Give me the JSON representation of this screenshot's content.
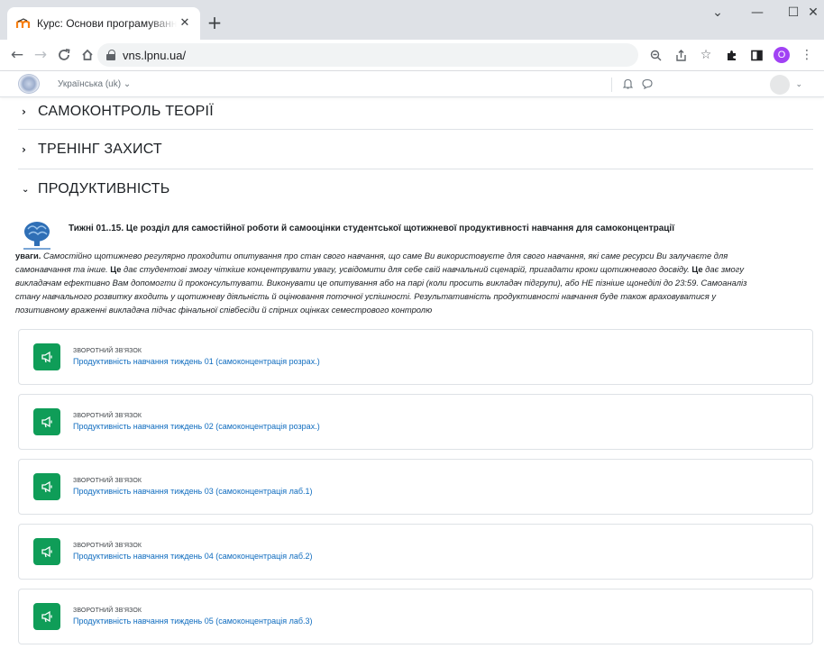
{
  "browser": {
    "tab_title": "Курс: Основи програмування, ч",
    "new_tab": "+",
    "url": "vns.lpnu.ua/",
    "profile_initial": "O"
  },
  "site": {
    "language": "Українська (uk)"
  },
  "sections": [
    {
      "title": "САМОКОНТРОЛЬ ТЕОРІЇ",
      "expanded": false
    },
    {
      "title": "ТРЕНІНГ ЗАХИСТ",
      "expanded": false
    },
    {
      "title": "ПРОДУКТИВНІСТЬ",
      "expanded": true
    }
  ],
  "summary": {
    "heading": "Тижні 01..15. Це розділ для самостійної роботи й самооцінки студентської щотижневої продуктивності навчання для самоконцентрації",
    "lead": "уваги.",
    "part1": " Самостійно щотижнево регулярно проходити опитування про стан свого навчання, що саме Ви використовуєте для свого навчання, які саме ресурси Ви залучаєте для самонавчання та інше. ",
    "bold1": "Це",
    "part2": " дає студентові змогу чіткіше концентрувати увагу, усвідомити для себе свій навчальний сценарій, пригадати кроки щотижневого досвіду. ",
    "bold2": "Це",
    "part3": " дає змогу викладачам ефективно Вам допомогти й проконсультувати. Виконувати це опитування або на парі (коли просить викладач підгрупи), або НЕ пізніше щонеділі до 23:59. Самоаналіз стану навчального розвитку входить у щотижневу діяльність й оцінювання поточної успішності. Результативність продуктивності навчання буде також враховуватися у позитивному враженні викладача підчас фінальної співбесіди й спірних оцінках семестрового контролю"
  },
  "activities": [
    {
      "type": "Зворотний зв'язок",
      "name": "Продуктивність навчання тиждень 01 (самоконцентрація розрах.)"
    },
    {
      "type": "Зворотний зв'язок",
      "name": "Продуктивність навчання тиждень 02 (самоконцентрація розрах.)"
    },
    {
      "type": "Зворотний зв'язок",
      "name": "Продуктивність навчання тиждень 03 (самоконцентрація лаб.1)"
    },
    {
      "type": "Зворотний зв'язок",
      "name": "Продуктивність навчання тиждень 04 (самоконцентрація лаб.2)"
    },
    {
      "type": "Зворотний зв'язок",
      "name": "Продуктивність навчання тиждень 05 (самоконцентрація лаб.3)"
    }
  ],
  "colors": {
    "activity_icon": "#0f9d58",
    "link": "#0f6cbf"
  }
}
